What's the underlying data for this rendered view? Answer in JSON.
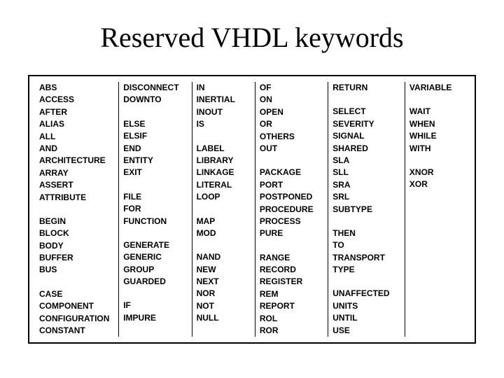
{
  "title": "Reserved VHDL keywords",
  "columns": [
    {
      "groups": [
        [
          "ABS",
          "ACCESS",
          "AFTER",
          "ALIAS",
          "ALL",
          "AND",
          "ARCHITECTURE",
          "ARRAY",
          "ASSERT",
          "ATTRIBUTE"
        ],
        [
          "BEGIN",
          "BLOCK",
          "BODY",
          "BUFFER",
          "BUS"
        ],
        [
          "CASE",
          "COMPONENT",
          "CONFIGURATION",
          "CONSTANT"
        ]
      ]
    },
    {
      "groups": [
        [
          "DISCONNECT",
          "DOWNTO"
        ],
        [
          "ELSE",
          "ELSIF",
          "END",
          "ENTITY",
          "EXIT"
        ],
        [
          "FILE",
          "FOR",
          "FUNCTION"
        ],
        [
          "GENERATE",
          "GENERIC",
          "GROUP",
          "GUARDED"
        ],
        [
          "IF",
          "IMPURE"
        ]
      ]
    },
    {
      "groups": [
        [
          "IN",
          "INERTIAL",
          "INOUT",
          "IS"
        ],
        [
          "LABEL",
          "LIBRARY",
          "LINKAGE",
          "LITERAL",
          "LOOP"
        ],
        [
          "MAP",
          "MOD"
        ],
        [
          "NAND",
          "NEW",
          "NEXT",
          "NOR",
          "NOT",
          "NULL"
        ]
      ]
    },
    {
      "groups": [
        [
          "OF",
          "ON",
          "OPEN",
          "OR",
          "OTHERS",
          "OUT"
        ],
        [
          "PACKAGE",
          "PORT",
          "POSTPONED",
          "PROCEDURE",
          "PROCESS",
          "PURE"
        ],
        [
          "RANGE",
          "RECORD",
          "REGISTER",
          "REM",
          "REPORT",
          "ROL",
          "ROR"
        ]
      ]
    },
    {
      "groups": [
        [
          "RETURN"
        ],
        [
          "SELECT",
          "SEVERITY",
          "SIGNAL",
          "SHARED",
          "SLA",
          "SLL",
          "SRA",
          "SRL",
          "SUBTYPE"
        ],
        [
          "THEN",
          "TO",
          "TRANSPORT",
          "TYPE"
        ],
        [
          "UNAFFECTED",
          "UNITS",
          "UNTIL",
          "USE"
        ]
      ]
    },
    {
      "groups": [
        [
          "VARIABLE"
        ],
        [
          "WAIT",
          "WHEN",
          "WHILE",
          "WITH"
        ],
        [
          "XNOR",
          "XOR"
        ]
      ]
    }
  ]
}
